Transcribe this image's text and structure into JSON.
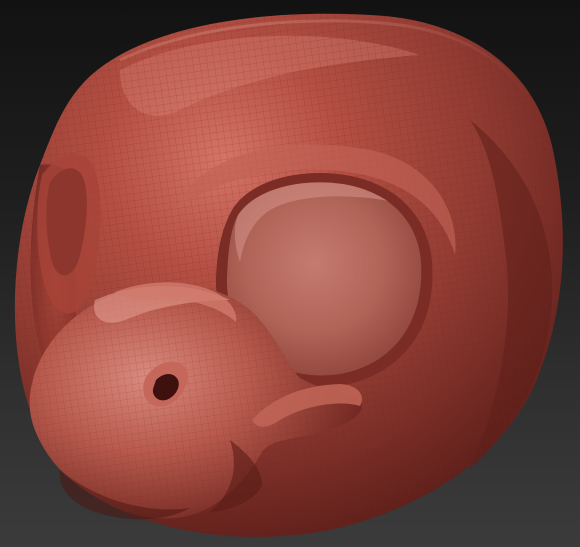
{
  "scene": {
    "subject": "sculpted-creature-head",
    "colors": {
      "background_top": "#121212",
      "background_bottom": "#3b3b3b",
      "clay_base": "#9c3f35",
      "clay_highlight": "#d06b5e",
      "clay_shadow": "#4a1613",
      "wireframe": "#7b2c25"
    }
  }
}
